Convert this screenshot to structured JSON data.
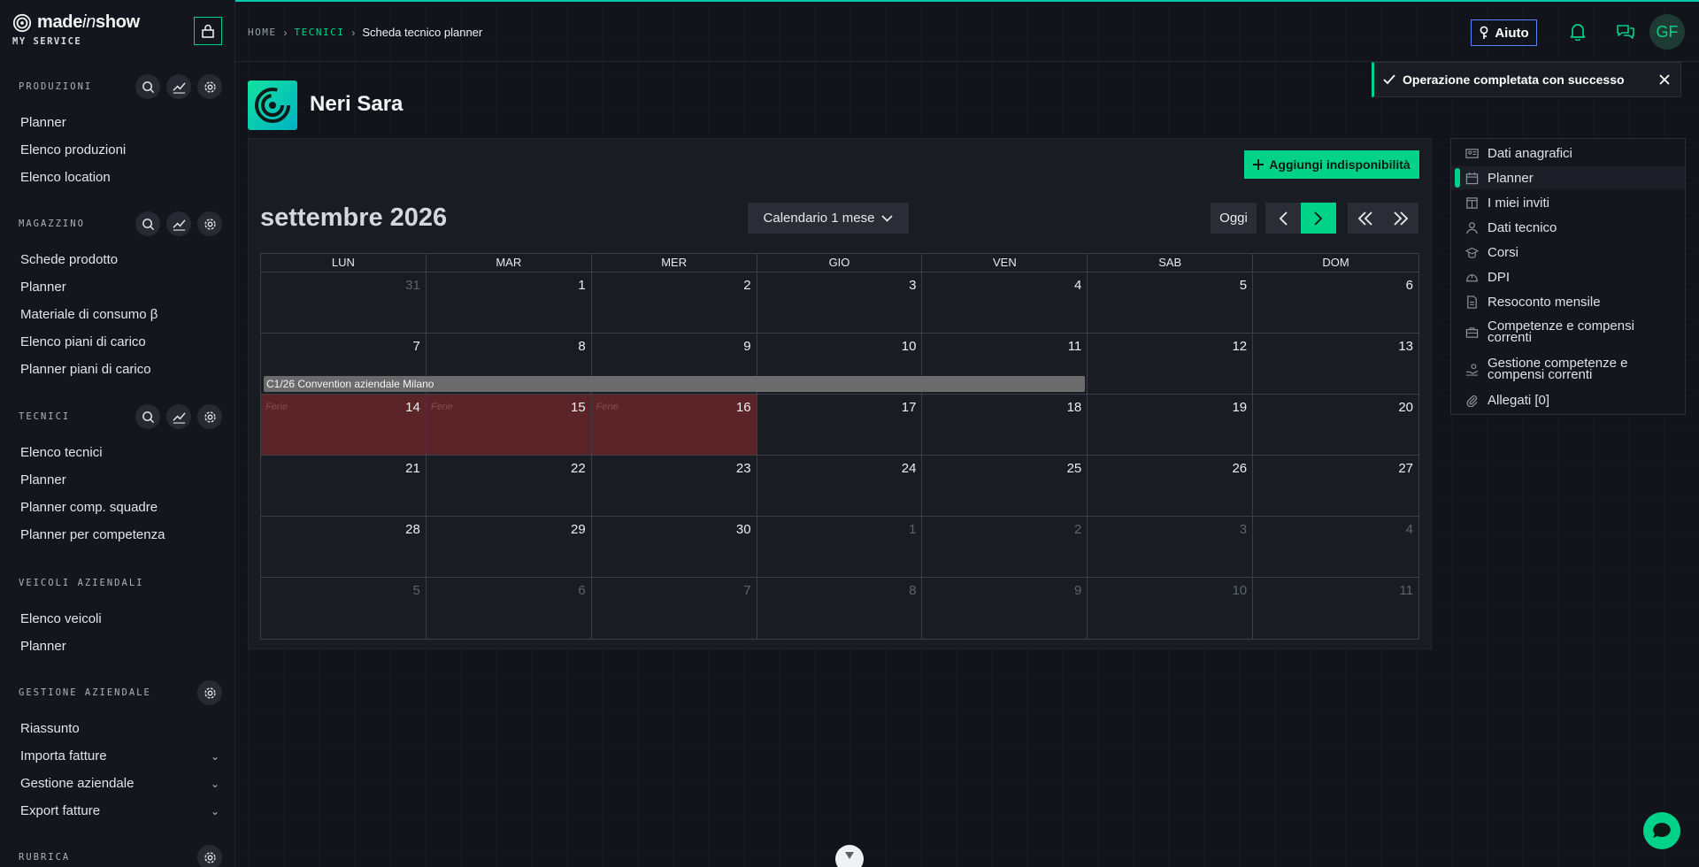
{
  "brand": {
    "name_part1": "made",
    "name_italic": "in",
    "name_part2": "show",
    "subtitle": "MY SERVICE"
  },
  "sidebar": {
    "sections": [
      {
        "title": "PRODUZIONI",
        "items": [
          "Planner",
          "Elenco produzioni",
          "Elenco location"
        ]
      },
      {
        "title": "MAGAZZINO",
        "items": [
          "Schede prodotto",
          "Planner",
          "Materiale di consumo β",
          "Elenco piani di carico",
          "Planner piani di carico"
        ]
      },
      {
        "title": "TECNICI",
        "items": [
          "Elenco tecnici",
          "Planner",
          "Planner comp. squadre",
          "Planner per competenza"
        ]
      },
      {
        "title": "VEICOLI AZIENDALI",
        "items": [
          "Elenco veicoli",
          "Planner"
        ]
      },
      {
        "title": "GESTIONE AZIENDALE",
        "items": [
          "Riassunto",
          "Importa fatture",
          "Gestione aziendale",
          "Export fatture"
        ]
      },
      {
        "title": "RUBRICA",
        "items": []
      }
    ]
  },
  "topbar": {
    "breadcrumb": {
      "home": "HOME",
      "section": "TECNICI",
      "current": "Scheda tecnico planner"
    },
    "help_label": "Aiuto",
    "avatar_initials": "GF"
  },
  "toast": {
    "message": "Operazione completata con successo"
  },
  "person": {
    "name": "Neri Sara"
  },
  "calendar": {
    "add_button": "Aggiungi indisponibilità",
    "month_title": "settembre 2026",
    "view_select": "Calendario 1 mese",
    "today_label": "Oggi",
    "weekdays": [
      "LUN",
      "MAR",
      "MER",
      "GIO",
      "VEN",
      "SAB",
      "DOM"
    ],
    "days": [
      "31",
      "1",
      "2",
      "3",
      "4",
      "5",
      "6",
      "7",
      "8",
      "9",
      "10",
      "11",
      "12",
      "13",
      "14",
      "15",
      "16",
      "17",
      "18",
      "19",
      "20",
      "21",
      "22",
      "23",
      "24",
      "25",
      "26",
      "27",
      "28",
      "29",
      "30",
      "1",
      "2",
      "3",
      "4",
      "5",
      "6",
      "7",
      "8",
      "9",
      "10",
      "11"
    ],
    "ferie_label": "Ferie",
    "event_title": "C1/26 Convention aziendale Milano"
  },
  "side_menu": {
    "items": [
      "Dati anagrafici",
      "Planner",
      "I miei inviti",
      "Dati tecnico",
      "Corsi",
      "DPI",
      "Resoconto mensile",
      "Competenze e compensi correnti",
      "Gestione competenze e compensi correnti",
      "Allegati [0]"
    ],
    "active": "Planner"
  }
}
